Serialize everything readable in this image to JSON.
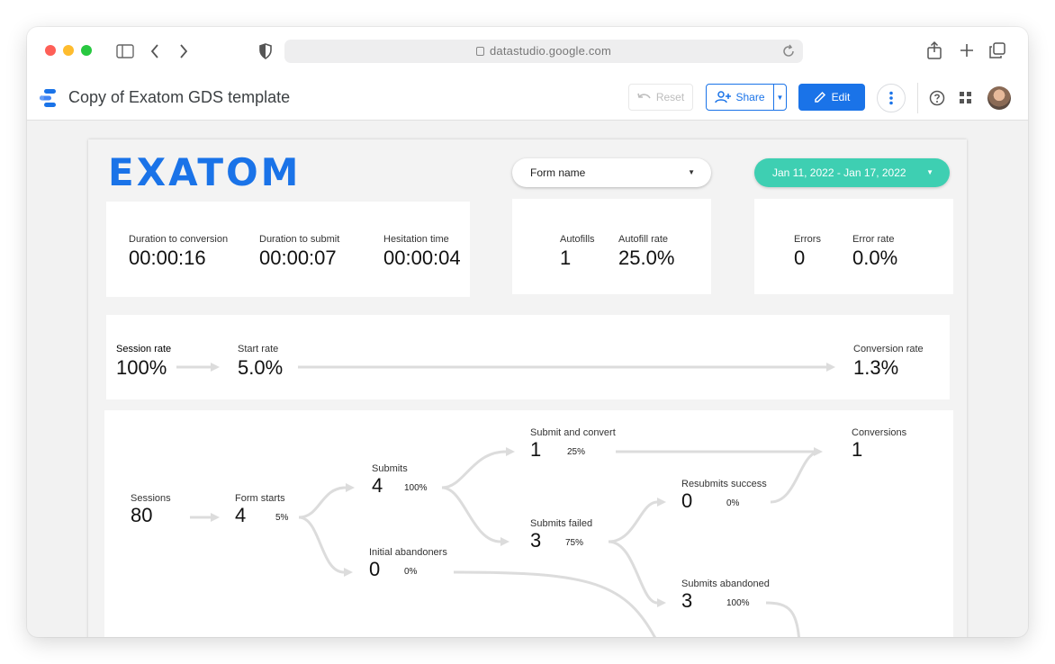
{
  "browser": {
    "url": "datastudio.google.com"
  },
  "app": {
    "title": "Copy of Exatom GDS template",
    "reset_label": "Reset",
    "share_label": "Share",
    "edit_label": "Edit",
    "accent": "#1a73e8"
  },
  "report": {
    "logo": "EXATOM",
    "form_filter": "Form name",
    "date_range": "Jan 11, 2022 - Jan 17, 2022",
    "scorecards": {
      "durations": [
        {
          "label": "Duration to conversion",
          "value": "00:00:16"
        },
        {
          "label": "Duration to submit",
          "value": "00:00:07"
        },
        {
          "label": "Hesitation time",
          "value": "00:00:04"
        }
      ],
      "autofill": [
        {
          "label": "Autofills",
          "value": "1"
        },
        {
          "label": "Autofill rate",
          "value": "25.0%"
        }
      ],
      "errors": [
        {
          "label": "Errors",
          "value": "0"
        },
        {
          "label": "Error rate",
          "value": "0.0%"
        }
      ]
    },
    "rates": [
      {
        "label": "Session rate",
        "value": "100%"
      },
      {
        "label": "Start rate",
        "value": "5.0%"
      },
      {
        "label": "Conversion rate",
        "value": "1.3%"
      }
    ],
    "funnel": {
      "sessions": {
        "label": "Sessions",
        "value": "80"
      },
      "form_starts": {
        "label": "Form starts",
        "value": "4",
        "pct": "5%"
      },
      "submits": {
        "label": "Submits",
        "value": "4",
        "pct": "100%"
      },
      "initial_abandoners": {
        "label": "Initial abandoners",
        "value": "0",
        "pct": "0%"
      },
      "submit_and_convert": {
        "label": "Submit and convert",
        "value": "1",
        "pct": "25%"
      },
      "submits_failed": {
        "label": "Submits failed",
        "value": "3",
        "pct": "75%"
      },
      "resubmits_success": {
        "label": "Resubmits success",
        "value": "0",
        "pct": "0%"
      },
      "submits_abandoned": {
        "label": "Submits abandoned",
        "value": "3",
        "pct": "100%"
      },
      "conversions": {
        "label": "Conversions",
        "value": "1"
      }
    },
    "date_accent": "#3ecfb2",
    "flow_color": "#dcdcdc"
  }
}
